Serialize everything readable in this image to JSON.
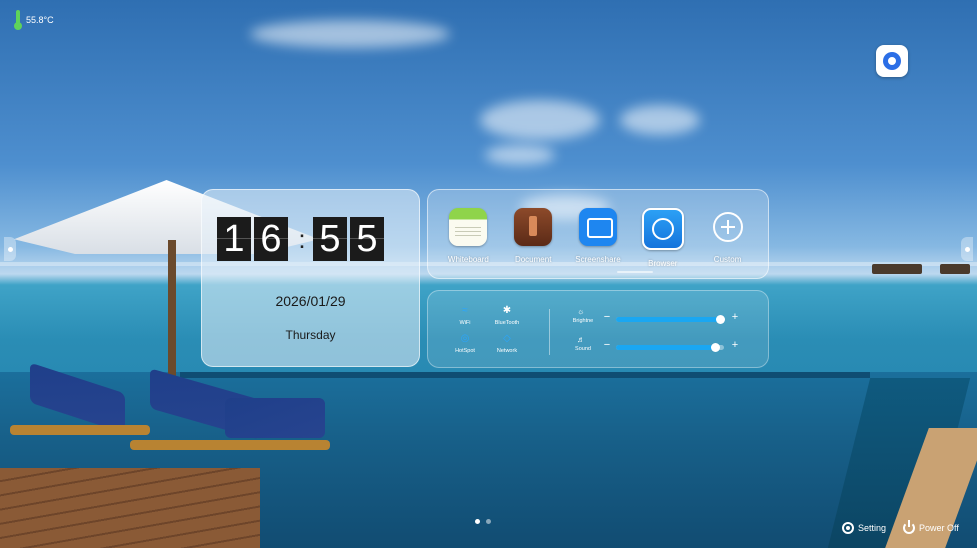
{
  "status": {
    "temperature": "55.8°C"
  },
  "clock": {
    "digits": [
      "1",
      "6",
      "5",
      "5"
    ],
    "separator": ":",
    "date": "2026/01/29",
    "weekday": "Thursday"
  },
  "apps": [
    {
      "label": "Whiteboard",
      "icon": "whiteboard-icon"
    },
    {
      "label": "Document",
      "icon": "document-icon"
    },
    {
      "label": "Screenshare",
      "icon": "screenshare-icon"
    },
    {
      "label": "Browser",
      "icon": "browser-icon"
    },
    {
      "label": "Custom",
      "icon": "add-circle-icon"
    }
  ],
  "quick_settings": [
    {
      "label": "WiFi",
      "icon": "wifi-icon"
    },
    {
      "label": "BlueTooth",
      "icon": "bluetooth-icon"
    },
    {
      "label": "HotSpot",
      "icon": "hotspot-icon"
    },
    {
      "label": "Network",
      "icon": "network-icon"
    }
  ],
  "sliders": {
    "brightness": {
      "label": "Brightne",
      "level": 0.97
    },
    "sound": {
      "label": "Sound",
      "level": 0.93
    }
  },
  "pager": {
    "pages": 2,
    "current": 1
  },
  "bottom": {
    "setting_label": "Setting",
    "power_label": "Power Off"
  },
  "colors": {
    "accent": "#1aa7f2",
    "temp_indicator": "#5fd35a"
  }
}
